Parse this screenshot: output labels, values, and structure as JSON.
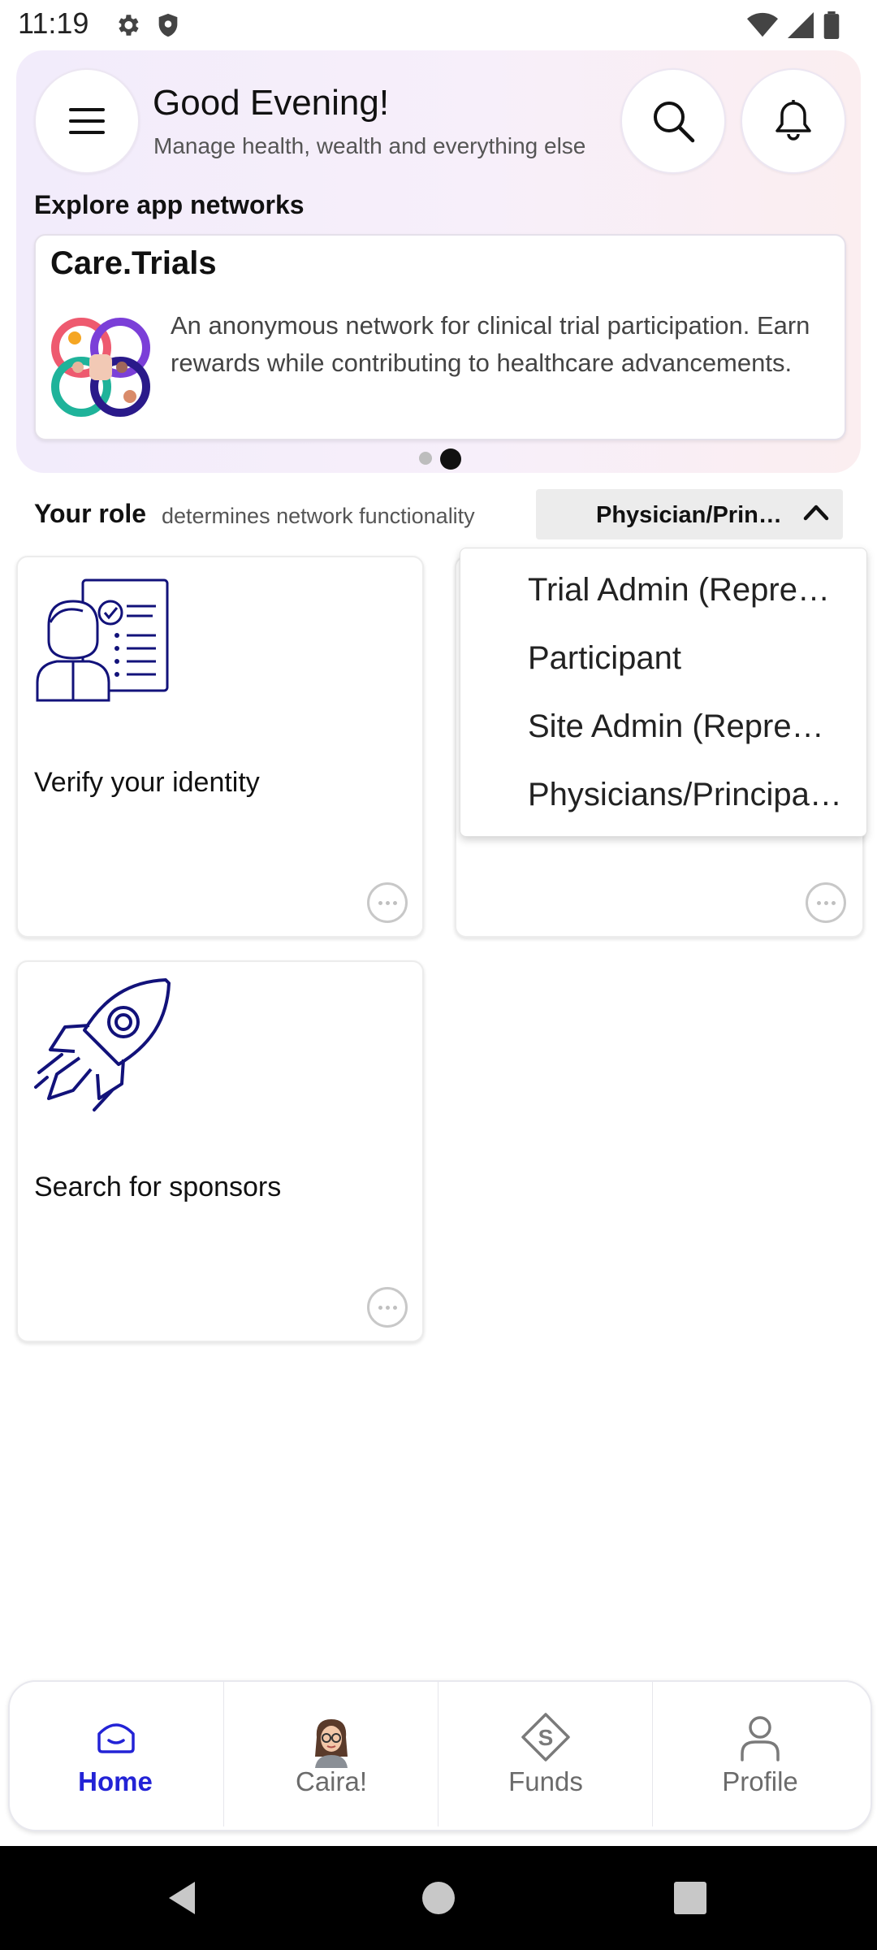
{
  "status_bar": {
    "time": "11:19",
    "icons": [
      "gear-icon",
      "shield-icon",
      "wifi-icon",
      "signal-icon",
      "battery-icon"
    ]
  },
  "header": {
    "greeting": "Good Evening!",
    "subtitle": "Manage health, wealth and everything else",
    "icons": [
      "menu-icon",
      "search-icon",
      "bell-icon"
    ]
  },
  "explore": {
    "label": "Explore app networks",
    "card": {
      "title": "Care.Trials",
      "description": "An anonymous network for clinical trial participation. Earn rewards while contributing to healthcare advancements."
    },
    "pagination": {
      "count": 2,
      "active": 2
    }
  },
  "role": {
    "label_bold": "Your role",
    "label_rest": "determines network functionality",
    "selected": "Physician/Prin…",
    "options": [
      "Trial Admin (Repre…",
      "Participant",
      "Site Admin (Repre…",
      "Physicians/Principa…"
    ]
  },
  "tiles": [
    {
      "label": "Verify your identity",
      "icon": "identity-checklist-icon"
    },
    {
      "label": "",
      "icon": ""
    },
    {
      "label": "Search for sponsors",
      "icon": "rocket-icon"
    }
  ],
  "bottom_nav": {
    "items": [
      {
        "label": "Home",
        "icon": "home-icon",
        "active": true
      },
      {
        "label": "Caira!",
        "icon": "avatar-icon",
        "active": false
      },
      {
        "label": "Funds",
        "icon": "funds-icon",
        "active": false
      },
      {
        "label": "Profile",
        "icon": "profile-icon",
        "active": false
      }
    ]
  },
  "colors": {
    "accent": "#2323d6",
    "icon_navy": "#12127a",
    "inactive": "#6b6b6b"
  }
}
